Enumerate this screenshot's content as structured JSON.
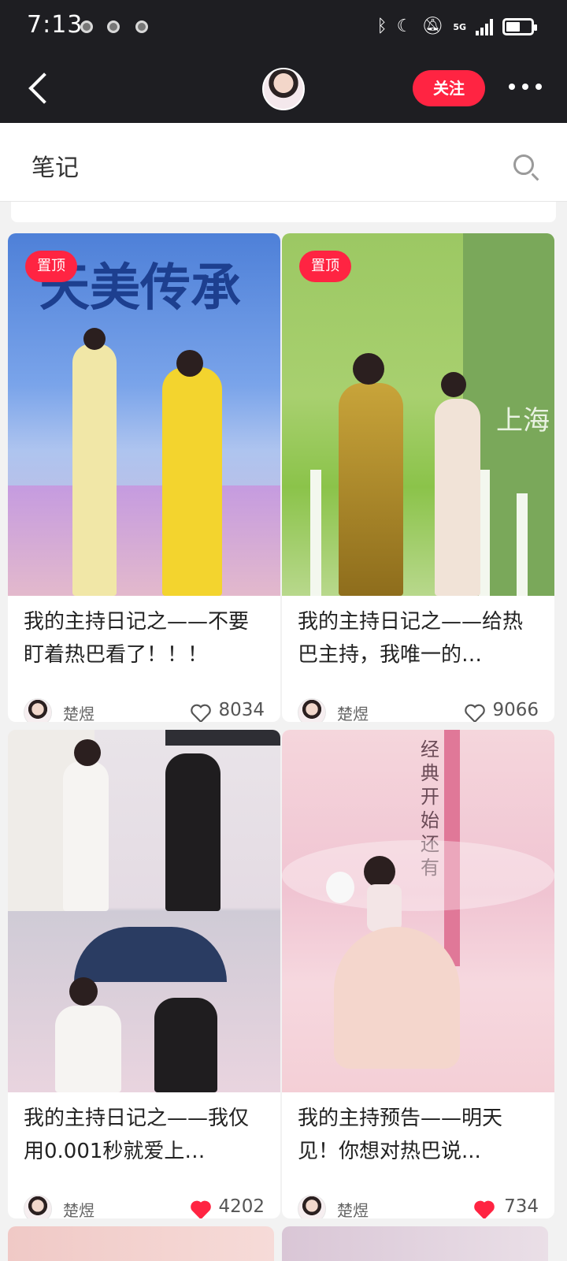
{
  "status_bar": {
    "time": "7:13",
    "network": "5G",
    "battery_level": 0.55
  },
  "header": {
    "follow_label": "关注"
  },
  "section": {
    "title": "笔记"
  },
  "cards": [
    {
      "pinned": true,
      "pin_label": "置顶",
      "title": "我的主持日记之——不要盯着热巴看了！！！",
      "author": "楚煜",
      "likes": "8034",
      "liked": false,
      "image_text": "天美传承"
    },
    {
      "pinned": true,
      "pin_label": "置顶",
      "title": "我的主持日记之——给热巴主持，我唯一的…",
      "author": "楚煜",
      "likes": "9066",
      "liked": false,
      "image_text": "上海"
    },
    {
      "pinned": false,
      "title": "我的主持日记之——我仅用0.001秒就爱上…",
      "author": "楚煜",
      "likes": "4202",
      "liked": true
    },
    {
      "pinned": false,
      "title": "我的主持预告——明天见！你想对热巴说...",
      "author": "楚煜",
      "likes": "734",
      "liked": true,
      "image_text": "经典开始还有"
    }
  ],
  "icons": [
    "back-icon",
    "more-icon",
    "search-icon",
    "heart-icon",
    "bluetooth-icon",
    "moon-icon",
    "mute-icon",
    "battery-icon"
  ],
  "colors": {
    "accent": "#ff2442",
    "header_bg": "#1e1e22"
  }
}
